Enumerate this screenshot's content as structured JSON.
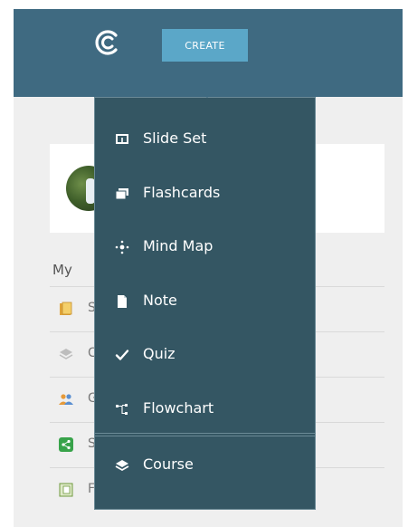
{
  "header": {
    "logo_icon": "brand-logo-icon",
    "create_label": "CREATE",
    "colors": {
      "header_bg": "#3f6a81",
      "button_bg": "#5ba7c8",
      "menu_bg": "#345663"
    }
  },
  "background": {
    "section_label": "My",
    "list_rows": [
      {
        "icon": "folder-icon",
        "text": "S"
      },
      {
        "icon": "course-icon",
        "text": "C"
      },
      {
        "icon": "group-icon",
        "text": "G"
      },
      {
        "icon": "share-icon",
        "text": "S"
      },
      {
        "icon": "notebook-icon",
        "text": "F"
      }
    ]
  },
  "menu": {
    "items": [
      {
        "label": "Slide Set",
        "icon": "slide-set-icon"
      },
      {
        "label": "Flashcards",
        "icon": "flashcards-icon"
      },
      {
        "label": "Mind Map",
        "icon": "mind-map-icon"
      },
      {
        "label": "Note",
        "icon": "note-icon"
      },
      {
        "label": "Quiz",
        "icon": "checkmark-icon"
      },
      {
        "label": "Flowchart",
        "icon": "flowchart-icon"
      }
    ],
    "course": {
      "label": "Course",
      "icon": "layers-icon"
    }
  }
}
